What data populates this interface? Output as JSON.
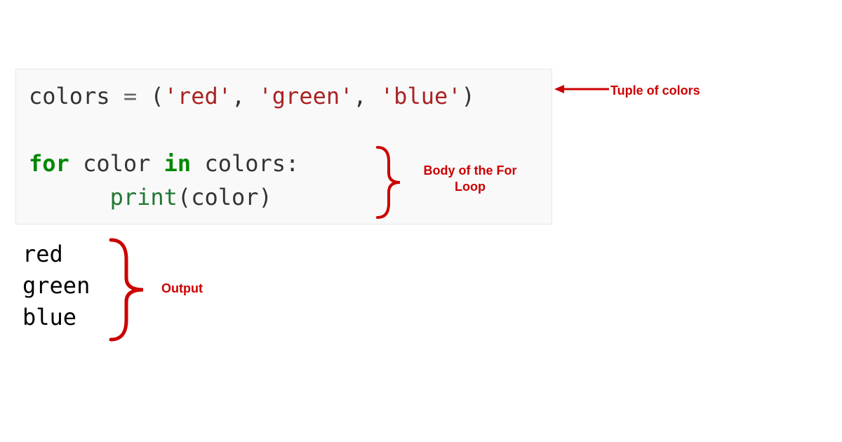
{
  "colors": {
    "annotation": "#cc0000",
    "keyword": "#008800",
    "string": "#aa2222",
    "function": "#227733",
    "codeBg": "#f9f9f9"
  },
  "code": {
    "line1": {
      "var": "colors",
      "eq": " = ",
      "open": "(",
      "s1": "'red'",
      "c1": ", ",
      "s2": "'green'",
      "c2": ", ",
      "s3": "'blue'",
      "close": ")"
    },
    "line2_for": "for",
    "line2_sp1": " ",
    "line2_var": "color",
    "line2_sp2": " ",
    "line2_in": "in",
    "line2_sp3": " ",
    "line2_iter": "colors",
    "line2_colon": ":",
    "line3_indent": "      ",
    "line3_func": "print",
    "line3_open": "(",
    "line3_arg": "color",
    "line3_close": ")"
  },
  "output": {
    "l1": "red",
    "l2": "green",
    "l3": "blue"
  },
  "annotations": {
    "tuple": "Tuple of colors",
    "body": "Body of the For Loop",
    "output": "Output"
  }
}
